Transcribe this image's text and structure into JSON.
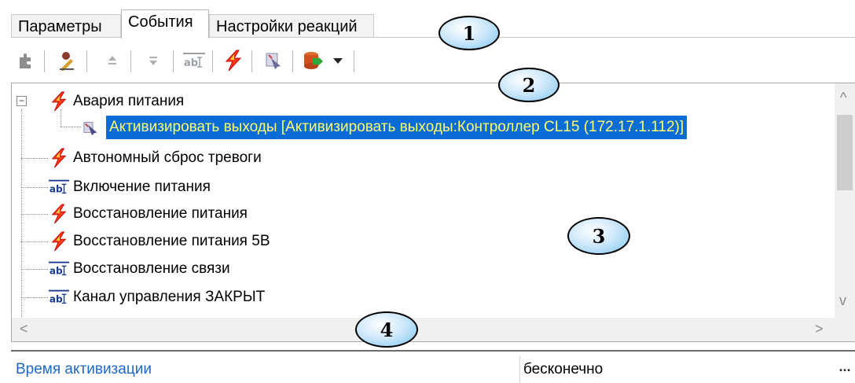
{
  "tabs": [
    {
      "label": "Параметры"
    },
    {
      "label": "События"
    },
    {
      "label": "Настройки реакций"
    }
  ],
  "active_tab": "События",
  "toolbar": {
    "buttons": [
      {
        "icon": "puzzle-add-icon"
      },
      {
        "icon": "edit-pencil-icon"
      },
      {
        "icon": "move-up-icon"
      },
      {
        "icon": "move-down-icon"
      },
      {
        "icon": "text-event-icon"
      },
      {
        "icon": "lightning-event-icon"
      },
      {
        "icon": "reaction-icon"
      },
      {
        "icon": "database-export-icon"
      }
    ]
  },
  "tree": {
    "rows": [
      {
        "label": "Авария питания",
        "icon": "lightning-icon",
        "expanded": true
      },
      {
        "label": "Активизировать выходы [Активизировать выходы:Контроллер CL15 (172.17.1.112)]",
        "icon": "reaction-icon",
        "selected": true
      },
      {
        "label": "Автономный сброс тревоги",
        "icon": "lightning-icon"
      },
      {
        "label": "Включение питания",
        "icon": "text-icon"
      },
      {
        "label": "Восстановление питания",
        "icon": "lightning-icon"
      },
      {
        "label": "Восстановление питания 5В",
        "icon": "lightning-icon"
      },
      {
        "label": "Восстановление связи",
        "icon": "text-icon"
      },
      {
        "label": "Канал управления ЗАКРЫТ",
        "icon": "text-icon"
      }
    ],
    "expander_symbol": "−"
  },
  "properties": {
    "name": "Время активизации",
    "value": "бесконечно",
    "ellipsis": "..."
  },
  "callouts": [
    "1",
    "2",
    "3",
    "4"
  ],
  "colors": {
    "selection_bg": "#0a6cd7",
    "selection_text": "#ffff6e",
    "property_name": "#1b6ac9",
    "callout_fill": "#7fc4f0"
  }
}
